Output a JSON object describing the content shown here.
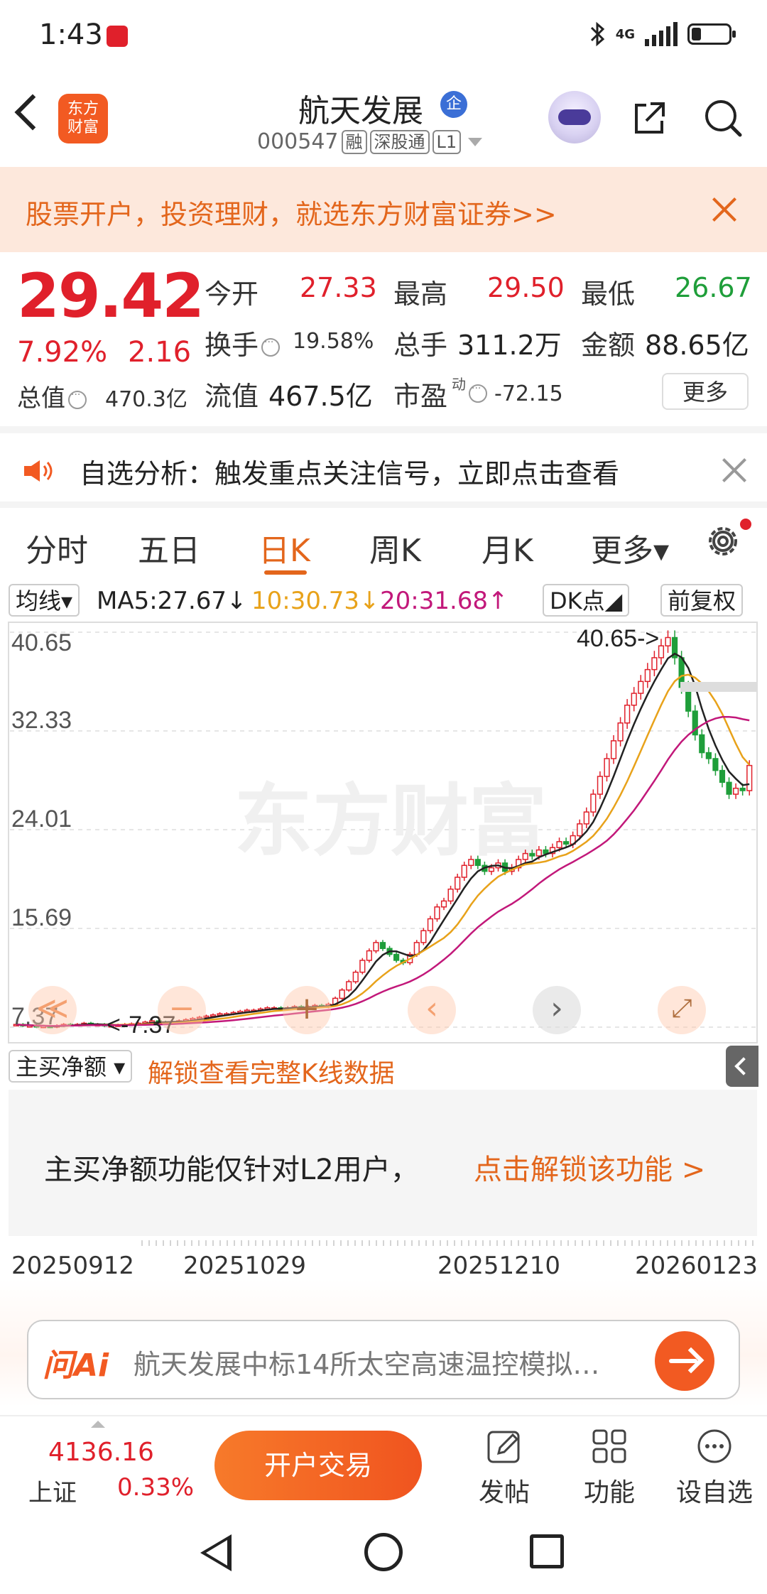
{
  "status_bar": {
    "time": "1:43",
    "network": "4G"
  },
  "header": {
    "app_logo": "东方\n财富",
    "stock_name": "航天发展",
    "badge": "企",
    "stock_code": "000547",
    "tags": [
      "融",
      "深股通",
      "L1"
    ]
  },
  "promo": {
    "text": "股票开户，投资理财，就选东方财富证券>>"
  },
  "quote": {
    "price": "29.42",
    "change_pct": "7.92%",
    "change": "2.16",
    "open_label": "今开",
    "open": "27.33",
    "high_label": "最高",
    "high": "29.50",
    "low_label": "最低",
    "low": "26.67",
    "turnover_label": "换手",
    "turnover": "19.58%",
    "volume_label": "总手",
    "volume": "311.2万",
    "amount_label": "金额",
    "amount": "88.65亿",
    "mcap_label": "总值",
    "mcap": "470.3亿",
    "float_label": "流值",
    "float": "467.5亿",
    "pe_label": "市盈",
    "pe_sup": "动",
    "pe": "-72.15",
    "more": "更多"
  },
  "alert": {
    "text": "自选分析：触发重点关注信号，立即点击查看"
  },
  "tabs": [
    "分时",
    "五日",
    "日K",
    "周K",
    "月K",
    "更多▾"
  ],
  "active_tab": "日K",
  "ma_row": {
    "selector": "均线▾",
    "ma5": "MA5:27.67↓",
    "ma10": "10:30.73↓",
    "ma20": "20:31.68↑",
    "dk": "DK点◢",
    "adjust": "前复权"
  },
  "colors": {
    "up": "#e0202b",
    "down": "#1f9e3a",
    "accent": "#e3661c",
    "ma5": "#222222",
    "ma10": "#e8a21a",
    "ma20": "#c2187a"
  },
  "chart_data": {
    "type": "candlestick",
    "y_ticks": [
      "40.65",
      "32.33",
      "24.01",
      "15.69",
      "7.37"
    ],
    "ylim": [
      7.37,
      40.65
    ],
    "annotations": {
      "max_label": "40.65->",
      "min_label": "<-7.37"
    },
    "watermark": "东方财富",
    "x_labels": [
      "20250912",
      "20251029",
      "20251210",
      "20260123"
    ],
    "closes": [
      7.6,
      7.5,
      7.5,
      7.4,
      7.45,
      7.4,
      7.5,
      7.6,
      7.55,
      7.6,
      7.7,
      7.6,
      7.6,
      7.5,
      7.5,
      7.55,
      7.6,
      7.65,
      7.7,
      7.8,
      7.9,
      7.8,
      7.75,
      7.8,
      7.9,
      8.0,
      8.1,
      8.2,
      8.3,
      8.4,
      8.5,
      8.5,
      8.6,
      8.7,
      8.8,
      8.8,
      8.9,
      9.0,
      9.0,
      8.9,
      9.0,
      9.1,
      9.0,
      9.1,
      9.2,
      9.1,
      9.3,
      9.8,
      10.5,
      11.2,
      12.0,
      13.0,
      13.8,
      14.5,
      14.0,
      13.5,
      13.0,
      12.8,
      13.5,
      14.5,
      15.5,
      16.5,
      17.5,
      18.0,
      19.0,
      20.0,
      21.0,
      21.5,
      21.0,
      20.5,
      20.8,
      21.2,
      20.5,
      20.8,
      21.5,
      22.0,
      21.8,
      22.3,
      22.0,
      22.5,
      23.0,
      22.8,
      23.5,
      24.5,
      25.5,
      27.0,
      28.5,
      30.0,
      31.5,
      33.0,
      34.5,
      35.5,
      36.5,
      37.5,
      38.5,
      39.5,
      40.2,
      38.5,
      36.0,
      34.0,
      32.0,
      30.5,
      30.0,
      29.0,
      28.0,
      27.0,
      27.5,
      27.3,
      29.42
    ]
  },
  "chart_nav": {
    "fast_back": "≪",
    "zoom_out": "−",
    "zoom_in": "+",
    "prev": "‹",
    "next": "›",
    "expand": "⤢"
  },
  "indicator": {
    "selector": "主买净额 ▾",
    "unlock": "解锁查看完整K线数据"
  },
  "lock_panel": {
    "text_a": "主买净额功能仅针对L2用户，",
    "text_b": "点击解锁该功能 >"
  },
  "ask_ai": {
    "logo": "问Ai",
    "text": "航天发展中标14所太空高速温控模拟…"
  },
  "bottom_bar": {
    "index_value": "4136.16",
    "index_name": "上证",
    "index_pct": "0.33%",
    "trade": "开户交易",
    "post": "发帖",
    "function": "功能",
    "watch": "设自选"
  }
}
